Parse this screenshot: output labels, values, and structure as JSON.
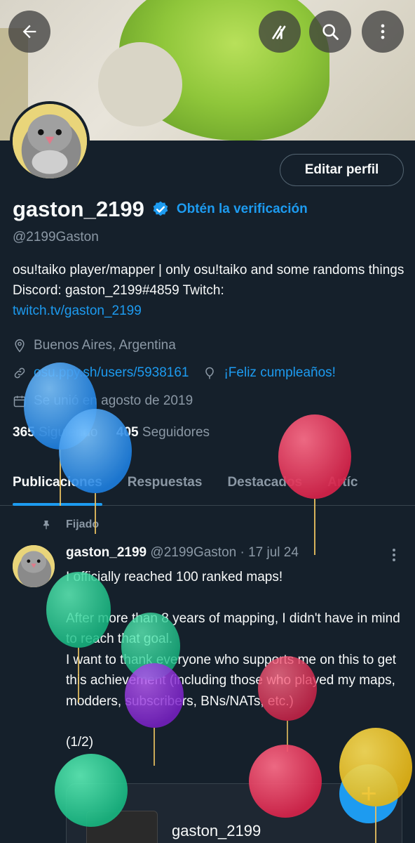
{
  "profile": {
    "name": "gaston_2199",
    "handle": "@2199Gaston",
    "get_verified": "Obtén la verificación",
    "edit_profile": "Editar perfil",
    "bio_text": "osu!taiko player/mapper | only osu!taiko and some randoms things  Discord: gaston_2199#4859 Twitch: ",
    "bio_link": "twitch.tv/gaston_2199",
    "location": "Buenos Aires, Argentina",
    "website": "osu.ppy.sh/users/5938161",
    "birthday": "¡Feliz cumpleaños!",
    "joined": "Se unió en agosto de 2019",
    "following_count": "365",
    "following_label": "Siguiendo",
    "followers_count": "405",
    "followers_label": "Seguidores"
  },
  "tabs": [
    {
      "label": "Publicaciones"
    },
    {
      "label": "Respuestas"
    },
    {
      "label": "Destacados"
    },
    {
      "label": "Artíc"
    }
  ],
  "tweet": {
    "pinned_label": "Fijado",
    "author": "gaston_2199",
    "handle_date": "@2199Gaston · 17 jul 24",
    "line1": "I officially reached 100 ranked maps!",
    "para2": "After more than 8 years of mapping, I didn't have in mind to reach that goal.",
    "para3": "I want to thank everyone who supports me on this to get this achievement (including those who played my maps, modders, subscribers, BNs/NATs, etc.)",
    "thread": "(1/2)",
    "quote_name": "gaston_2199"
  },
  "fab_label": "+",
  "colors": {
    "background": "#15202b",
    "accent": "#1d9bf0",
    "muted": "#8b98a5"
  }
}
